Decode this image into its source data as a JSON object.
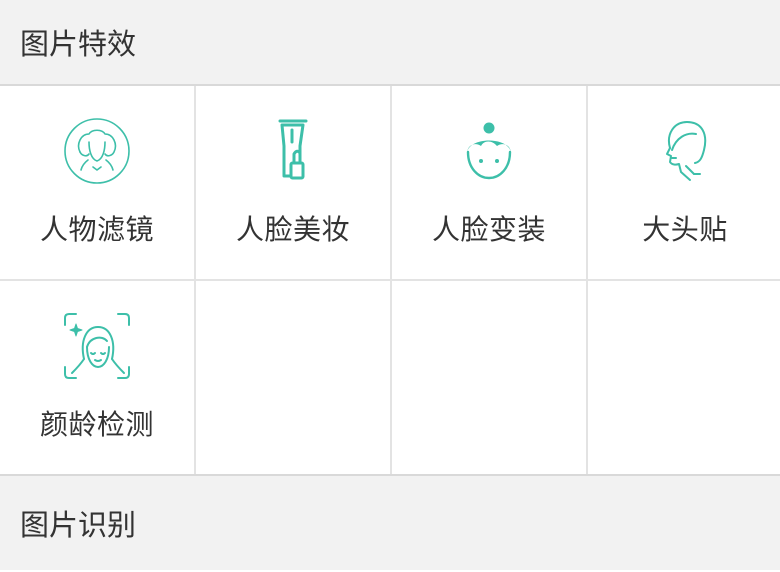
{
  "sections": {
    "effects": {
      "title": "图片特效"
    },
    "recognition": {
      "title": "图片识别"
    }
  },
  "effects": [
    {
      "label": "人物滤镜",
      "icon": "portrait-filter-icon"
    },
    {
      "label": "人脸美妆",
      "icon": "makeup-icon"
    },
    {
      "label": "人脸变装",
      "icon": "face-dressup-icon"
    },
    {
      "label": "大头贴",
      "icon": "sticker-profile-icon"
    },
    {
      "label": "颜龄检测",
      "icon": "age-detection-icon"
    }
  ],
  "colors": {
    "accent": "#3dbfa9",
    "text": "#333333",
    "header_bg": "#f2f2f2"
  }
}
